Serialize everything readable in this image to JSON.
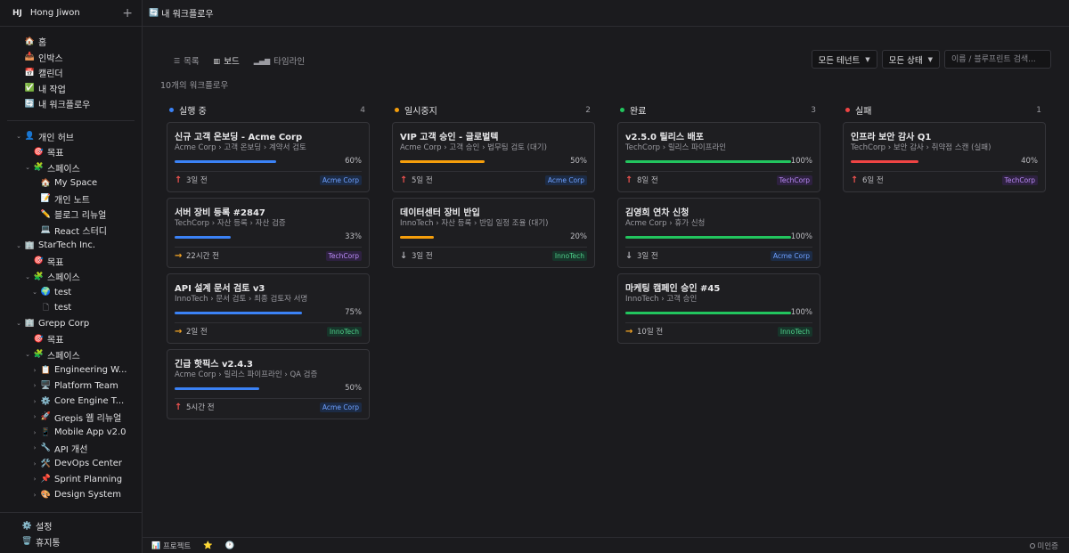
{
  "workspace": {
    "initials": "HJ",
    "name": "Hong Jiwon",
    "add_icon": "+"
  },
  "nav": [
    {
      "icon": "🏠",
      "label": "홈"
    },
    {
      "icon": "📥",
      "label": "인박스"
    },
    {
      "icon": "📅",
      "label": "캘린더"
    },
    {
      "icon": "✅",
      "label": "내 작업"
    },
    {
      "icon": "🔄",
      "label": "내 워크플로우"
    }
  ],
  "tree": {
    "personal": {
      "icon": "👤",
      "label": "개인 허브",
      "goals": "목표",
      "spaces": "스페이스",
      "items": [
        {
          "icon": "🏠",
          "label": "My Space"
        },
        {
          "icon": "📝",
          "label": "개인 노트"
        },
        {
          "icon": "✏️",
          "label": "블로그 리뉴얼"
        },
        {
          "icon": "💻",
          "label": "React 스터디"
        }
      ]
    },
    "startech": {
      "icon": "🏢",
      "label": "StarTech Inc.",
      "goals": "목표",
      "spaces": "스페이스",
      "space": {
        "icon": "🌍",
        "label": "test"
      },
      "doc": {
        "label": "test"
      }
    },
    "grepp": {
      "icon": "🏢",
      "label": "Grepp Corp",
      "goals": "목표",
      "spaces": "스페이스",
      "items": [
        {
          "icon": "📋",
          "label": "Engineering W..."
        },
        {
          "icon": "🖥️",
          "label": "Platform Team"
        },
        {
          "icon": "⚙️",
          "label": "Core Engine T..."
        },
        {
          "icon": "🚀",
          "label": "Grepis 웹 리뉴얼"
        },
        {
          "icon": "📱",
          "label": "Mobile App v2.0"
        },
        {
          "icon": "🔧",
          "label": "API 개선"
        },
        {
          "icon": "🛠️",
          "label": "DevOps Center"
        },
        {
          "icon": "📌",
          "label": "Sprint Planning"
        },
        {
          "icon": "🎨",
          "label": "Design System"
        }
      ]
    }
  },
  "bottom_nav": [
    {
      "icon": "⚙️",
      "label": "설정"
    },
    {
      "icon": "🗑️",
      "label": "휴지통"
    }
  ],
  "topbar": {
    "icon": "🔄",
    "title": "내 워크플로우"
  },
  "views": {
    "list": "목록",
    "board": "보드",
    "timeline": "타임라인"
  },
  "filters": {
    "tenant": "모든 테넌트",
    "status": "모든 상태",
    "search_placeholder": "이름 / 블루프린트 검색..."
  },
  "count_text": "10개의 워크플로우",
  "colors": {
    "blue": "#3b82f6",
    "orange": "#f59e0b",
    "green": "#22c55e",
    "red": "#ef4444"
  },
  "columns": [
    {
      "title": "실행 중",
      "count": "4",
      "color": "#3b82f6",
      "cards": [
        {
          "title": "신규 고객 온보딩 - Acme Corp",
          "path": "Acme Corp › 고객 온보딩 › 계약서 검토",
          "progress": 60,
          "pct": "60%",
          "arrow": "↑",
          "time": "3일 전",
          "tag": "Acme Corp"
        },
        {
          "title": "서버 장비 등록 #2847",
          "path": "TechCorp › 자산 등록 › 자산 검증",
          "progress": 33,
          "pct": "33%",
          "arrow": "→",
          "time": "22시간 전",
          "tag": "TechCorp"
        },
        {
          "title": "API 설계 문서 검토 v3",
          "path": "InnoTech › 문서 검토 › 최종 검토자 서명",
          "progress": 75,
          "pct": "75%",
          "arrow": "→",
          "time": "2일 전",
          "tag": "InnoTech"
        },
        {
          "title": "긴급 핫픽스 v2.4.3",
          "path": "Acme Corp › 릴리스 파이프라인 › QA 검증",
          "progress": 50,
          "pct": "50%",
          "arrow": "↑",
          "time": "5시간 전",
          "tag": "Acme Corp"
        }
      ]
    },
    {
      "title": "일시중지",
      "count": "2",
      "color": "#f59e0b",
      "cards": [
        {
          "title": "VIP 고객 승인 - 글로벌텍",
          "path": "Acme Corp › 고객 승인 › 법무팀 검토 (대기)",
          "progress": 50,
          "pct": "50%",
          "arrow": "↑",
          "time": "5일 전",
          "tag": "Acme Corp"
        },
        {
          "title": "데이터센터 장비 반입",
          "path": "InnoTech › 자산 등록 › 반입 일정 조율 (대기)",
          "progress": 20,
          "pct": "20%",
          "arrow": "↓",
          "time": "3일 전",
          "tag": "InnoTech"
        }
      ]
    },
    {
      "title": "완료",
      "count": "3",
      "color": "#22c55e",
      "cards": [
        {
          "title": "v2.5.0 릴리스 배포",
          "path": "TechCorp › 릴리스 파이프라인",
          "progress": 100,
          "pct": "100%",
          "arrow": "↑",
          "time": "8일 전",
          "tag": "TechCorp"
        },
        {
          "title": "김영희 연차 신청",
          "path": "Acme Corp › 휴가 신청",
          "progress": 100,
          "pct": "100%",
          "arrow": "↓",
          "time": "3일 전",
          "tag": "Acme Corp"
        },
        {
          "title": "마케팅 캠페인 승인 #45",
          "path": "InnoTech › 고객 승인",
          "progress": 100,
          "pct": "100%",
          "arrow": "→",
          "time": "10일 전",
          "tag": "InnoTech"
        }
      ]
    },
    {
      "title": "실패",
      "count": "1",
      "color": "#ef4444",
      "cards": [
        {
          "title": "인프라 보안 감사 Q1",
          "path": "TechCorp › 보안 감사 › 취약점 스캔 (실패)",
          "progress": 40,
          "pct": "40%",
          "arrow": "↑",
          "time": "6일 전",
          "tag": "TechCorp"
        }
      ]
    }
  ],
  "statusbar": {
    "projects_icon": "📊",
    "projects": "프로젝트",
    "star_icon": "⭐",
    "clock_icon": "🕐",
    "connection": "미인증"
  }
}
